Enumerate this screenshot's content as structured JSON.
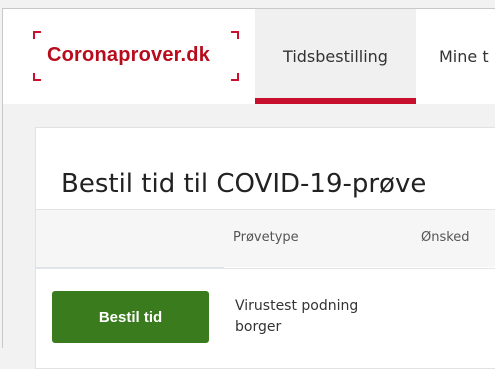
{
  "header": {
    "logo_text": "Coronaprover.dk",
    "tabs": [
      {
        "label": "Tidsbestilling",
        "active": true
      },
      {
        "label": "Mine t",
        "active": false
      }
    ]
  },
  "main": {
    "title": "Bestil tid til COVID-19-prøve",
    "table": {
      "columns": [
        "Prøvetype",
        "Ønsked"
      ],
      "rows": [
        {
          "action_label": "Bestil tid",
          "test_type": "Virustest podning borger"
        }
      ]
    }
  },
  "colors": {
    "brand_red": "#c8102e",
    "button_green": "#3a7c1d"
  }
}
